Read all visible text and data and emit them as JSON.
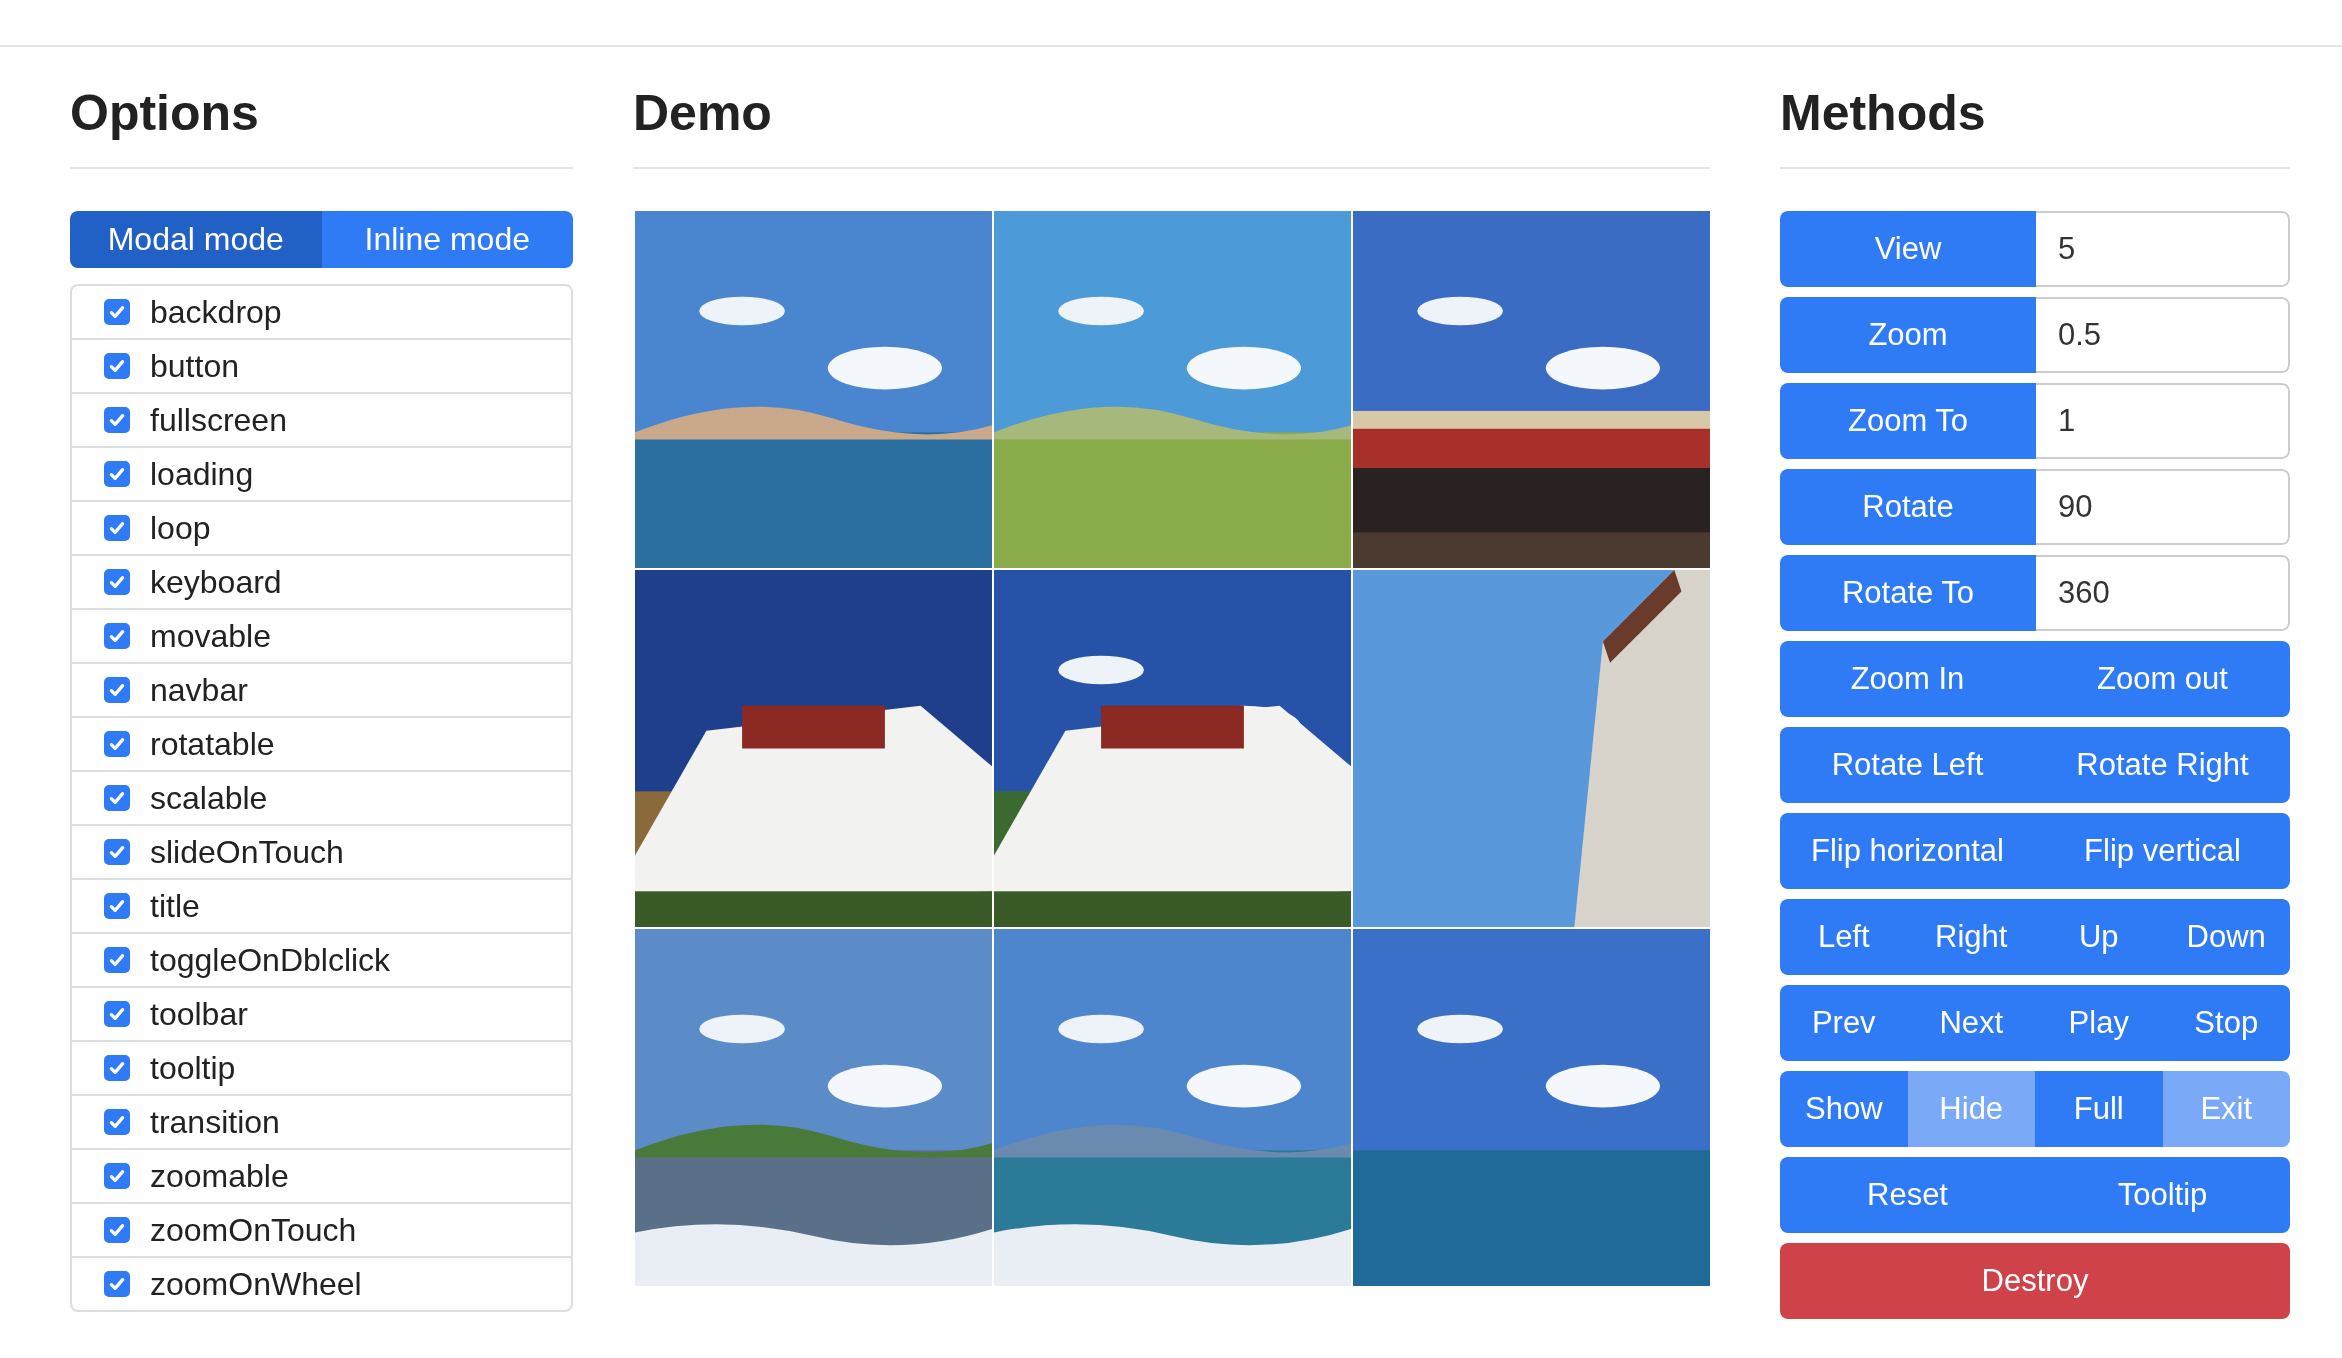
{
  "options": {
    "heading": "Options",
    "modes": [
      {
        "label": "Modal mode",
        "selected": true
      },
      {
        "label": "Inline mode",
        "selected": false
      }
    ],
    "checkboxes": [
      {
        "label": "backdrop",
        "checked": true
      },
      {
        "label": "button",
        "checked": true
      },
      {
        "label": "fullscreen",
        "checked": true
      },
      {
        "label": "loading",
        "checked": true
      },
      {
        "label": "loop",
        "checked": true
      },
      {
        "label": "keyboard",
        "checked": true
      },
      {
        "label": "movable",
        "checked": true
      },
      {
        "label": "navbar",
        "checked": true
      },
      {
        "label": "rotatable",
        "checked": true
      },
      {
        "label": "scalable",
        "checked": true
      },
      {
        "label": "slideOnTouch",
        "checked": true
      },
      {
        "label": "title",
        "checked": true
      },
      {
        "label": "toggleOnDblclick",
        "checked": true
      },
      {
        "label": "toolbar",
        "checked": true
      },
      {
        "label": "tooltip",
        "checked": true
      },
      {
        "label": "transition",
        "checked": true
      },
      {
        "label": "zoomable",
        "checked": true
      },
      {
        "label": "zoomOnTouch",
        "checked": true
      },
      {
        "label": "zoomOnWheel",
        "checked": true
      }
    ]
  },
  "demo": {
    "heading": "Demo"
  },
  "methods": {
    "heading": "Methods",
    "rows": [
      {
        "kind": "input",
        "button": "View",
        "value": "5"
      },
      {
        "kind": "input",
        "button": "Zoom",
        "value": "0.5"
      },
      {
        "kind": "input",
        "button": "Zoom To",
        "value": "1"
      },
      {
        "kind": "input",
        "button": "Rotate",
        "value": "90"
      },
      {
        "kind": "input",
        "button": "Rotate To",
        "value": "360"
      },
      {
        "kind": "group",
        "buttons": [
          {
            "label": "Zoom In",
            "disabled": false
          },
          {
            "label": "Zoom out",
            "disabled": false
          }
        ]
      },
      {
        "kind": "group",
        "buttons": [
          {
            "label": "Rotate Left",
            "disabled": false
          },
          {
            "label": "Rotate Right",
            "disabled": false
          }
        ]
      },
      {
        "kind": "group",
        "buttons": [
          {
            "label": "Flip horizontal",
            "disabled": false
          },
          {
            "label": "Flip vertical",
            "disabled": false
          }
        ]
      },
      {
        "kind": "group",
        "buttons": [
          {
            "label": "Left",
            "disabled": false
          },
          {
            "label": "Right",
            "disabled": false
          },
          {
            "label": "Up",
            "disabled": false
          },
          {
            "label": "Down",
            "disabled": false
          }
        ]
      },
      {
        "kind": "group",
        "buttons": [
          {
            "label": "Prev",
            "disabled": false
          },
          {
            "label": "Next",
            "disabled": false
          },
          {
            "label": "Play",
            "disabled": false
          },
          {
            "label": "Stop",
            "disabled": false
          }
        ]
      },
      {
        "kind": "group",
        "buttons": [
          {
            "label": "Show",
            "disabled": false
          },
          {
            "label": "Hide",
            "disabled": true
          },
          {
            "label": "Full",
            "disabled": false
          },
          {
            "label": "Exit",
            "disabled": true
          }
        ]
      },
      {
        "kind": "group",
        "buttons": [
          {
            "label": "Reset",
            "disabled": false
          },
          {
            "label": "Tooltip",
            "disabled": false
          }
        ]
      },
      {
        "kind": "danger",
        "buttons": [
          {
            "label": "Destroy",
            "disabled": false
          }
        ]
      }
    ]
  }
}
